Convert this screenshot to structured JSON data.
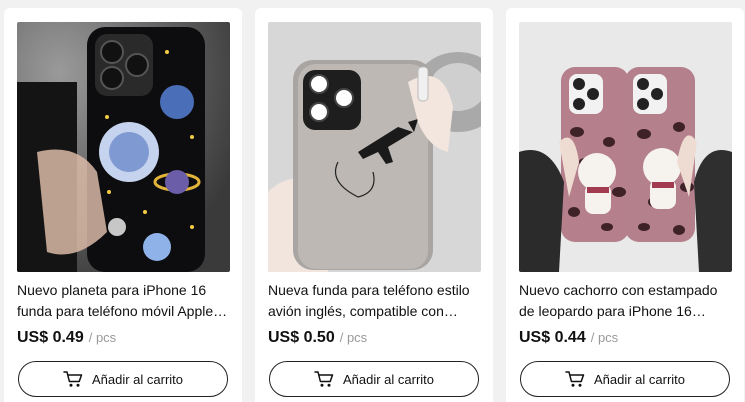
{
  "products": [
    {
      "title": "Nuevo planeta para iPhone 16 funda para teléfono móvil Apple…",
      "price": "US$ 0.49",
      "unit": "/ pcs",
      "button_label": "Añadir al carrito",
      "image": "black-phone-case-with-planets-held-in-hand"
    },
    {
      "title": "Nueva funda para teléfono estilo avión inglés, compatible con…",
      "price": "US$ 0.50",
      "unit": "/ pcs",
      "button_label": "Añadir al carrito",
      "image": "grey-phone-case-with-airplane-held-in-hand"
    },
    {
      "title": "Nuevo cachorro con estampado de leopardo para iPhone 16 fund…",
      "price": "US$ 0.44",
      "unit": "/ pcs",
      "button_label": "Añadir al carrito",
      "image": "two-pink-leopard-print-cases-with-puppy"
    }
  ],
  "colors": {
    "price": "#111111",
    "unit": "#999999",
    "button_border": "#222222",
    "card_bg": "#ffffff",
    "page_bg": "#f1f1f1"
  },
  "icons": {
    "cart": "shopping-cart-icon"
  }
}
